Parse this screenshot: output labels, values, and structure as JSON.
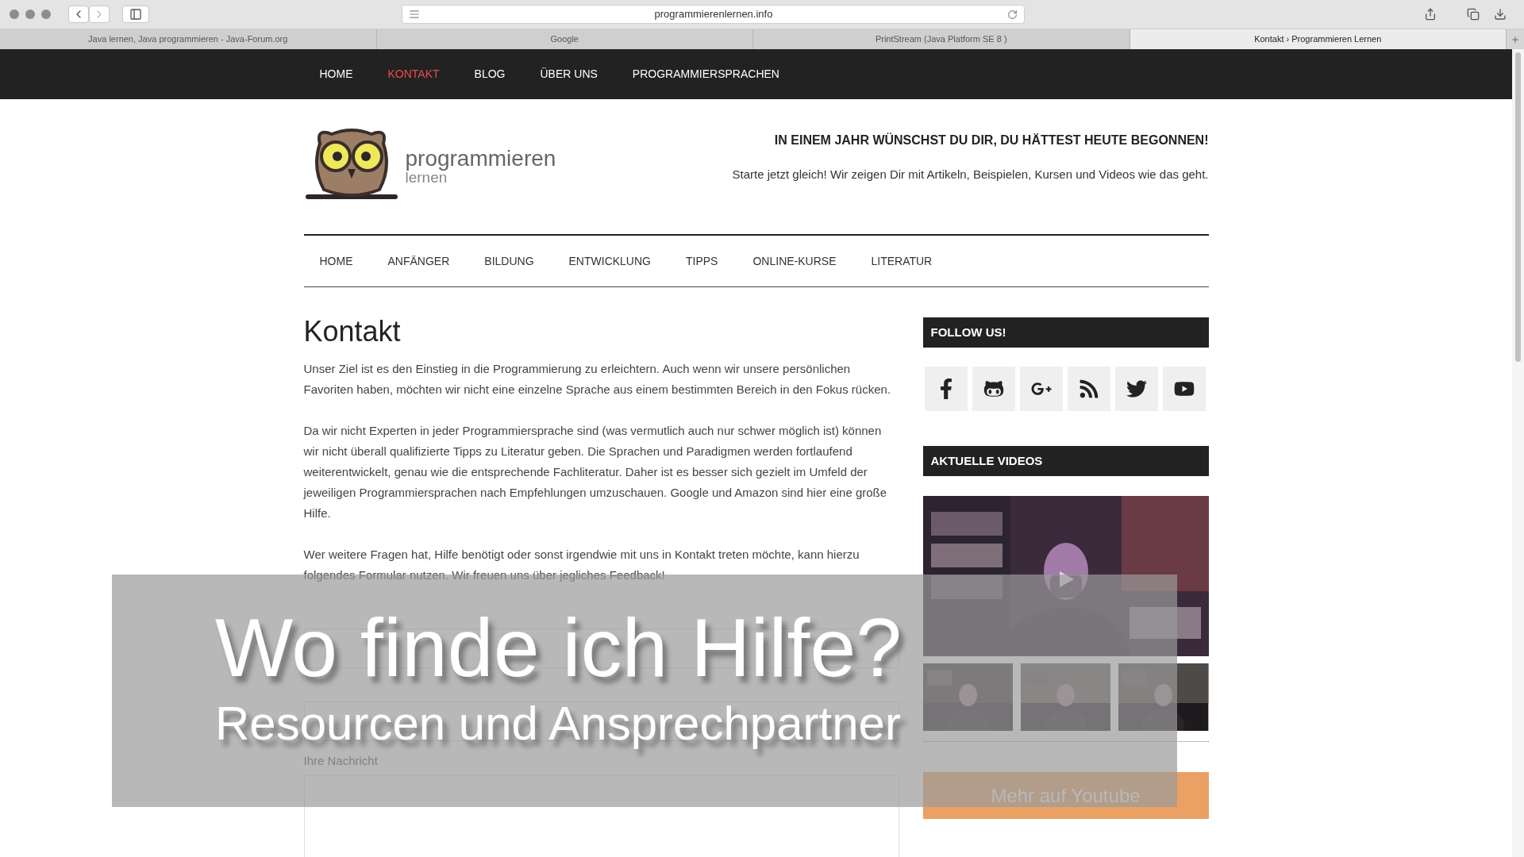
{
  "browser": {
    "url": "programmierenlernen.info",
    "tabs": [
      {
        "label": "Java lernen, Java programmieren - Java-Forum.org",
        "selected": false
      },
      {
        "label": "Google",
        "selected": false
      },
      {
        "label": "PrintStream (Java Platform SE 8 )",
        "selected": false
      },
      {
        "label": "Kontakt › Programmieren Lernen",
        "selected": true
      }
    ]
  },
  "top_nav": [
    {
      "label": "HOME",
      "selected": false
    },
    {
      "label": "KONTAKT",
      "selected": true
    },
    {
      "label": "BLOG",
      "selected": false
    },
    {
      "label": "ÜBER UNS",
      "selected": false
    },
    {
      "label": "PROGRAMMIERSPRACHEN",
      "selected": false
    }
  ],
  "logo": {
    "title": "programmieren",
    "subtitle": "lernen"
  },
  "tagline": {
    "heading": "IN EINEM JAHR WÜNSCHST DU DIR, DU HÄTTEST HEUTE BEGONNEN!",
    "text": "Starte jetzt gleich! Wir zeigen Dir mit Artikeln, Beispielen, Kursen und Videos wie das geht."
  },
  "main_nav": [
    "HOME",
    "ANFÄNGER",
    "BILDUNG",
    "ENTWICKLUNG",
    "TIPPS",
    "ONLINE-KURSE",
    "LITERATUR"
  ],
  "page": {
    "title": "Kontakt",
    "paragraphs": [
      "Unser Ziel ist es den Einstieg in die Programmierung zu erleichtern. Auch wenn wir unsere persönlichen Favoriten haben, möchten wir nicht eine einzelne Sprache aus einem bestimmten Bereich in den Fokus rücken.",
      "Da wir nicht Experten in jeder Programmiersprache sind (was vermutlich auch nur schwer möglich ist) können wir nicht überall qualifizierte Tipps zu Literatur geben. Die Sprachen und Paradigmen werden fortlaufend weiterentwickelt, genau wie die entsprechende Fachliteratur. Daher ist es besser sich gezielt im Umfeld der jeweiligen Programmiersprachen nach Empfehlungen umzuschauen. Google und Amazon sind hier eine große Hilfe.",
      "Wer weitere Fragen hat, Hilfe benötigt oder sonst irgendwie mit uns in Kontakt treten möchte, kann hierzu folgendes Formular nutzen. Wir freuen uns über jegliches Feedback!"
    ],
    "form": [
      {
        "kind": "input"
      },
      {
        "kind": "input"
      },
      {
        "label": "Ihre Nachricht",
        "kind": "textarea"
      }
    ]
  },
  "sidebar": {
    "follow_title": "FOLLOW US!",
    "social": [
      {
        "kind": "facebook"
      },
      {
        "kind": "github"
      },
      {
        "kind": "googleplus"
      },
      {
        "kind": "rss"
      },
      {
        "kind": "twitter"
      },
      {
        "kind": "youtube"
      }
    ],
    "videos_title": "AKTUELLE VIDEOS",
    "button": "Mehr auf Youtube"
  },
  "overlay": {
    "title": "Wo finde ich Hilfe?",
    "subtitle": "Resourcen und Ansprechpartner"
  }
}
